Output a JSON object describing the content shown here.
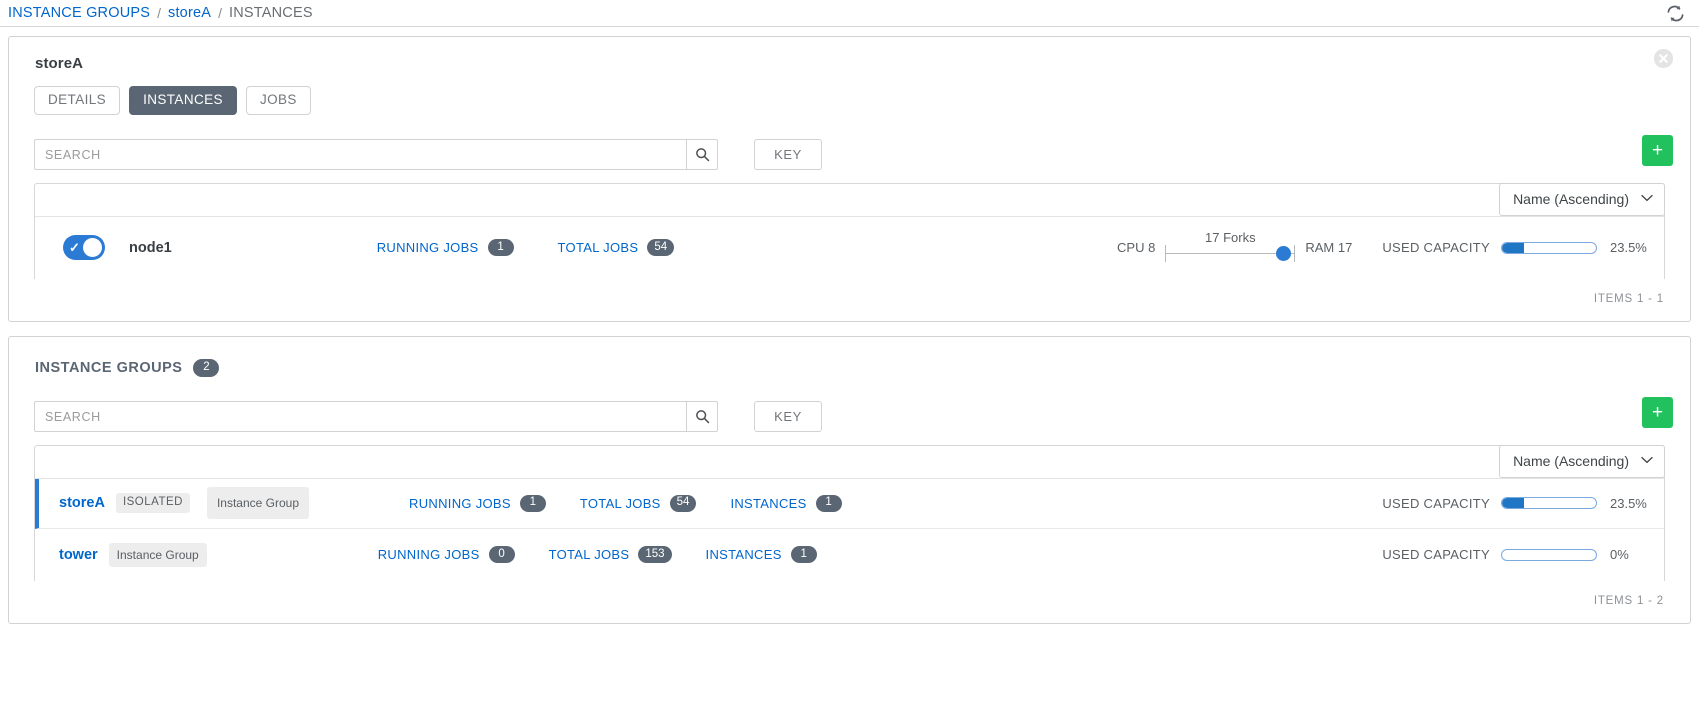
{
  "breadcrumb": {
    "items": [
      {
        "label": "INSTANCE GROUPS",
        "current": false
      },
      {
        "label": "storeA",
        "current": false
      },
      {
        "label": "INSTANCES",
        "current": true
      }
    ],
    "separator": "/",
    "refresh_icon": "refresh-icon"
  },
  "colors": {
    "link": "#0066cc",
    "accent_blue": "#2b7bd4",
    "add_green": "#21c15e",
    "badge_gray": "#5a6673",
    "tab_active": "#5a6673"
  },
  "detail_card": {
    "title": "storeA",
    "close_label": "✕",
    "tabs": [
      {
        "label": "DETAILS",
        "active": false
      },
      {
        "label": "INSTANCES",
        "active": true
      },
      {
        "label": "JOBS",
        "active": false
      }
    ],
    "toolbar": {
      "search_placeholder": "SEARCH",
      "search_value": "",
      "search_icon": "search-icon",
      "key_label": "KEY",
      "add_label": "+"
    },
    "sort": {
      "label": "Name (Ascending)",
      "chevron": "⌄"
    },
    "instances": [
      {
        "toggle_on": true,
        "name": "node1",
        "running_jobs_label": "RUNNING JOBS",
        "running_jobs_value": "1",
        "total_jobs_label": "TOTAL JOBS",
        "total_jobs_value": "54",
        "cpu_label": "CPU 8",
        "forks_label": "17 Forks",
        "ram_label": "RAM 17",
        "capacity_label": "USED CAPACITY",
        "capacity_percent": "23.5%",
        "capacity_fill": 23.5
      }
    ],
    "items_count": "ITEMS  1 - 1"
  },
  "groups_card": {
    "title": "INSTANCE GROUPS",
    "count": "2",
    "toolbar": {
      "search_placeholder": "SEARCH",
      "search_value": "",
      "search_icon": "search-icon",
      "key_label": "KEY",
      "add_label": "+"
    },
    "sort": {
      "label": "Name (Ascending)",
      "chevron": "⌄"
    },
    "rows": [
      {
        "name": "storeA",
        "selected": true,
        "isolated_badge": "ISOLATED",
        "type_chip": "Instance Group",
        "running_jobs_label": "RUNNING JOBS",
        "running_jobs_value": "1",
        "total_jobs_label": "TOTAL JOBS",
        "total_jobs_value": "54",
        "instances_label": "INSTANCES",
        "instances_value": "1",
        "capacity_label": "USED CAPACITY",
        "capacity_percent": "23.5%",
        "capacity_fill": 23.5
      },
      {
        "name": "tower",
        "selected": false,
        "isolated_badge": "",
        "type_chip": "Instance Group",
        "running_jobs_label": "RUNNING JOBS",
        "running_jobs_value": "0",
        "total_jobs_label": "TOTAL JOBS",
        "total_jobs_value": "153",
        "instances_label": "INSTANCES",
        "instances_value": "1",
        "capacity_label": "USED CAPACITY",
        "capacity_percent": "0%",
        "capacity_fill": 0
      }
    ],
    "items_count": "ITEMS  1 - 2"
  }
}
